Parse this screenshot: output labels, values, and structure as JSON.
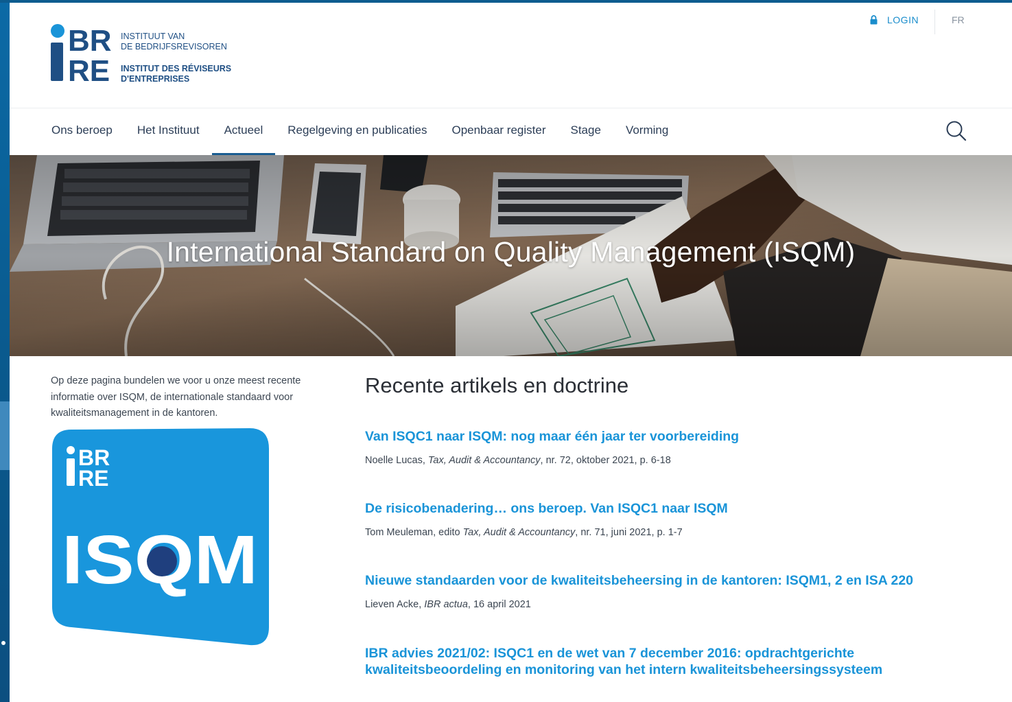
{
  "header": {
    "logo": {
      "mark_top": "BR",
      "mark_bottom": "RE",
      "line1": "INSTITUUT VAN",
      "line2": "DE BEDRIJFSREVISOREN",
      "line3": "INSTITUT DES RÉVISEURS",
      "line4": "D'ENTREPRISES"
    },
    "login_label": "LOGIN",
    "lang_label": "FR"
  },
  "nav": {
    "items": [
      {
        "label": "Ons beroep"
      },
      {
        "label": "Het Instituut"
      },
      {
        "label": "Actueel",
        "active": true
      },
      {
        "label": "Regelgeving en publicaties"
      },
      {
        "label": "Openbaar register"
      },
      {
        "label": "Stage"
      },
      {
        "label": "Vorming"
      }
    ]
  },
  "hero": {
    "title": "International Standard on Quality Management (ISQM)"
  },
  "sidebar": {
    "intro": "Op deze pagina bundelen we voor u onze meest recente informatie over ISQM, de internationale standaard voor kwaliteitsmanagement in de kantoren.",
    "badge": {
      "mark_top": "BR",
      "mark_bottom": "RE",
      "word": "ISQM"
    }
  },
  "main": {
    "heading": "Recente artikels en doctrine",
    "articles": [
      {
        "title": "Van ISQC1 naar ISQM: nog maar één jaar ter voorbereiding",
        "author": "Noelle Lucas, ",
        "source": "Tax, Audit & Accountancy",
        "rest": ", nr. 72, oktober 2021, p. 6-18"
      },
      {
        "title": "De risicobenadering… ons beroep. Van ISQC1 naar ISQM",
        "author": "Tom Meuleman, edito ",
        "source": "Tax, Audit & Accountancy",
        "rest": ", nr. 71, juni 2021, p. 1-7"
      },
      {
        "title": "Nieuwe standaarden voor de kwaliteitsbeheersing in de kantoren: ISQM1, 2 en ISA 220",
        "author": "Lieven Acke, ",
        "source": "IBR actua",
        "rest": ", 16 april 2021"
      },
      {
        "title": "IBR advies 2021/02: ISQC1 en de wet van 7 december 2016: opdrachtgerichte kwaliteitsbeoordeling en monitoring van het intern kwaliteitsbeheersingssysteem"
      }
    ]
  },
  "colors": {
    "brand_blue": "#1a94d8",
    "nav_text": "#2c3e57",
    "logo_navy": "#1f4f84",
    "badge_blue": "#1996dc"
  },
  "icons": {
    "login": "lock-icon",
    "search": "search-icon"
  }
}
